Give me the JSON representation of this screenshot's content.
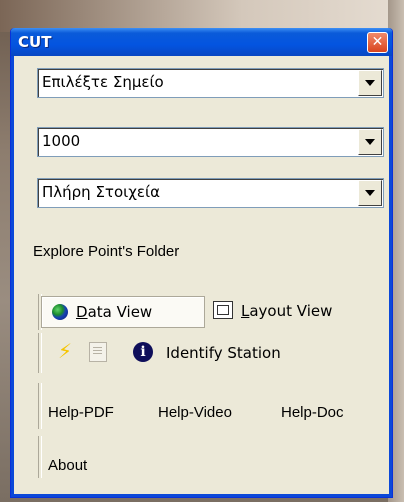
{
  "window": {
    "title": "CUT",
    "close_symbol": "✕"
  },
  "dropdowns": [
    {
      "value": "Επιλέξτε Σημείο"
    },
    {
      "value": "1000"
    },
    {
      "value": "Πλήρη Στοιχεία"
    }
  ],
  "explore_label": "Explore Point's Folder",
  "views": {
    "data_view": {
      "label_first": "D",
      "label_rest": "ata View",
      "icon": "globe-icon",
      "active": true
    },
    "layout_view": {
      "label_first": "L",
      "label_rest": "ayout View",
      "icon": "layout-icon",
      "active": false
    }
  },
  "tools": {
    "bolt_icon": "lightning-icon",
    "doc_icon": "document-icon",
    "identify_label": "Identify Station",
    "info_icon": "info-icon"
  },
  "help_links": [
    "Help-PDF",
    "Help-Video",
    "Help-Doc"
  ],
  "about_label": "About"
}
